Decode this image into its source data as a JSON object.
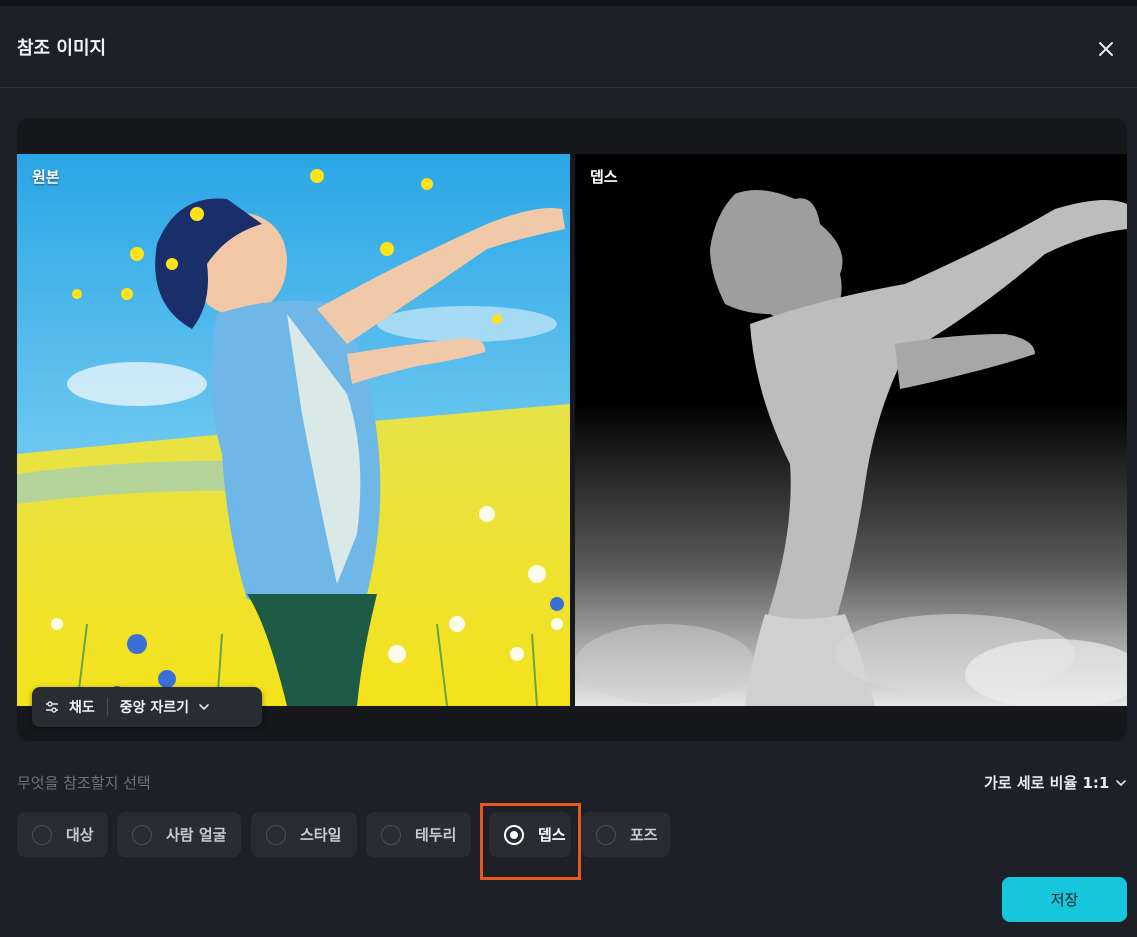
{
  "dialog": {
    "title": "참조 이미지",
    "close_icon": "close-icon"
  },
  "preview": {
    "original_label": "원본",
    "depth_label": "뎁스",
    "toolbar": {
      "adjust_icon": "sliders-icon",
      "saturation_label": "채도",
      "crop_label": "중앙 자르기",
      "crop_icon": "chevron-down-icon"
    }
  },
  "reference": {
    "prompt": "무엇을 참조할지 선택",
    "ratio_label": "가로 세로 비율 1:1",
    "options": [
      {
        "label": "대상",
        "selected": false
      },
      {
        "label": "사람 얼굴",
        "selected": false
      },
      {
        "label": "스타일",
        "selected": false
      },
      {
        "label": "테두리",
        "selected": false
      },
      {
        "label": "뎁스",
        "selected": true
      },
      {
        "label": "포즈",
        "selected": false
      }
    ]
  },
  "actions": {
    "save_label": "저장"
  },
  "colors": {
    "accent": "#16c6dc",
    "highlight": "#e8571e",
    "background": "#1e2027"
  }
}
